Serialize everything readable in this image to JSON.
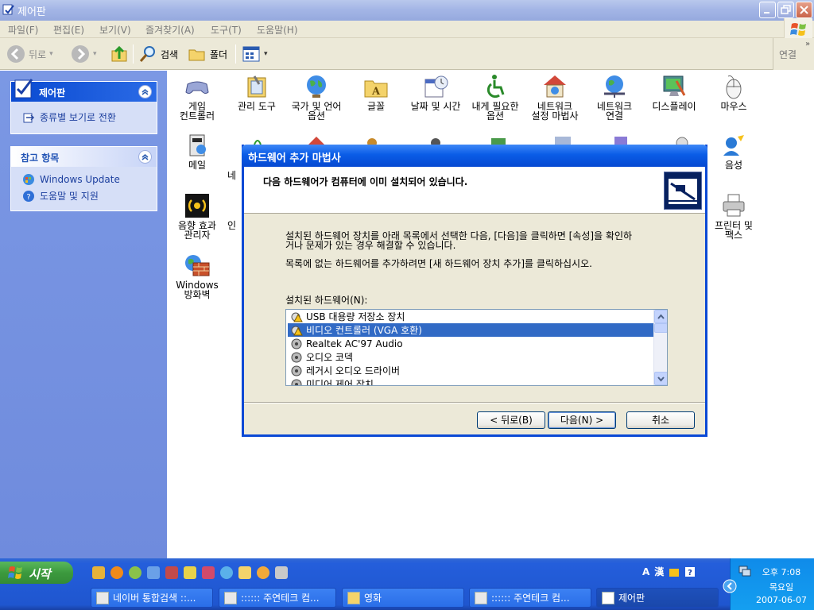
{
  "window": {
    "title": "제어판"
  },
  "menu": [
    "파일(F)",
    "편집(E)",
    "보기(V)",
    "즐겨찾기(A)",
    "도구(T)",
    "도움말(H)"
  ],
  "toolbar": {
    "back": "뒤로",
    "search": "검색",
    "folders": "폴더",
    "links": "연결"
  },
  "left_pane": {
    "panel1": {
      "title": "제어판",
      "link": "종류별 보기로 전환"
    },
    "panel2": {
      "title": "참고 항목",
      "links": [
        "Windows Update",
        "도움말 및 지원"
      ]
    }
  },
  "icons": [
    {
      "l1": "게임",
      "l2": "컨트롤러"
    },
    {
      "l1": "관리 도구",
      "l2": ""
    },
    {
      "l1": "국가 및 언어",
      "l2": "옵션"
    },
    {
      "l1": "글꼴",
      "l2": ""
    },
    {
      "l1": "날짜 및 시간",
      "l2": ""
    },
    {
      "l1": "내게 필요한",
      "l2": "옵션"
    },
    {
      "l1": "네트워크",
      "l2": "설정 마법사"
    },
    {
      "l1": "네트워크",
      "l2": "연결"
    },
    {
      "l1": "디스플레이",
      "l2": ""
    },
    {
      "l1": "마우스",
      "l2": ""
    },
    {
      "l1": "메일",
      "l2": ""
    },
    {
      "l1": "음성",
      "l2": ""
    },
    {
      "l1": "음향 효과",
      "l2": "관리자"
    },
    {
      "l1": "프린터 및",
      "l2": "팩스"
    },
    {
      "l1": "Windows",
      "l2": "방화벽"
    },
    {
      "l1": "네",
      "l2": ""
    },
    {
      "l1": "인",
      "l2": ""
    }
  ],
  "dialog": {
    "title": "하드웨어 추가 마법사",
    "header": "다음 하드웨어가 컴퓨터에 이미 설치되어 있습니다.",
    "line1": "설치된 하드웨어 장치를 아래 목록에서 선택한 다음, [다음]을 클릭하면 [속성]을 확인하",
    "line2": "거나 문제가 있는 경우 해결할 수 있습니다.",
    "line3": "목록에 없는 하드웨어를 추가하려면 [새 하드웨어 장치 추가]를 클릭하십시오.",
    "list_label": "설치된 하드웨어(N):",
    "items": [
      "USB 대용량 저장소 장치",
      "비디오 컨트롤러 (VGA 호환)",
      "Realtek AC'97 Audio",
      "오디오 코덱",
      "레거시 오디오 드라이버",
      "미디어 제어 장치"
    ],
    "selected_index": 1,
    "buttons": {
      "back": "< 뒤로(B)",
      "next": "다음(N) >",
      "cancel": "취소"
    }
  },
  "taskbar": {
    "start": "시작",
    "tasks": [
      "네이버 통합검색 ::...",
      ":::::: 주연테크 컴...",
      "영화",
      ":::::: 주연테크 컴...",
      "제어판"
    ],
    "active_task": 4,
    "lang": {
      "a": "A",
      "han": "漢"
    },
    "clock": {
      "time": "오후 7:08",
      "day": "목요일",
      "date": "2007-06-07"
    }
  }
}
